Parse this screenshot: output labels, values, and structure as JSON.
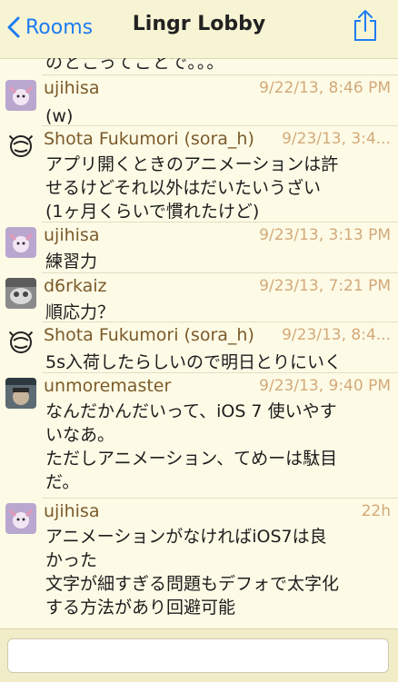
{
  "nav": {
    "back_label": "Rooms",
    "title": "Lingr Lobby"
  },
  "cutoff_text": "のとこってことで。。。",
  "messages": [
    {
      "name": "ujihisa",
      "time": "9/22/13, 8:46 PM",
      "lines": [
        "(w)"
      ]
    },
    {
      "name": "Shota Fukumori (sora_h)",
      "time": "9/23/13, 3:4...",
      "lines": [
        "アプリ開くときのアニメーションは許",
        "せるけどそれ以外はだいたいうざい",
        "(1ヶ月くらいで慣れたけど)"
      ]
    },
    {
      "name": "ujihisa",
      "time": "9/23/13, 3:13 PM",
      "lines": [
        "練習力"
      ]
    },
    {
      "name": "d6rkaiz",
      "time": "9/23/13, 7:21 PM",
      "lines": [
        "順応力？"
      ]
    },
    {
      "name": "Shota Fukumori (sora_h)",
      "time": "9/23/13, 8:4...",
      "lines": [
        "5s入荷したらしいので明日とりにいく"
      ]
    },
    {
      "name": "unmoremaster",
      "time": "9/23/13, 9:40 PM",
      "lines": [
        "なんだかんだいって、iOS 7 使いやす",
        "いなあ。",
        "ただしアニメーション、てめーは駄目",
        "だ。"
      ]
    },
    {
      "name": "ujihisa",
      "time": "22h",
      "lines": [
        "アニメーションがなければiOS7は良",
        "かった",
        "文字が細すぎる問題もデフォで太字化",
        "する方法があり回避可能"
      ]
    }
  ],
  "composer": {
    "placeholder": ""
  }
}
